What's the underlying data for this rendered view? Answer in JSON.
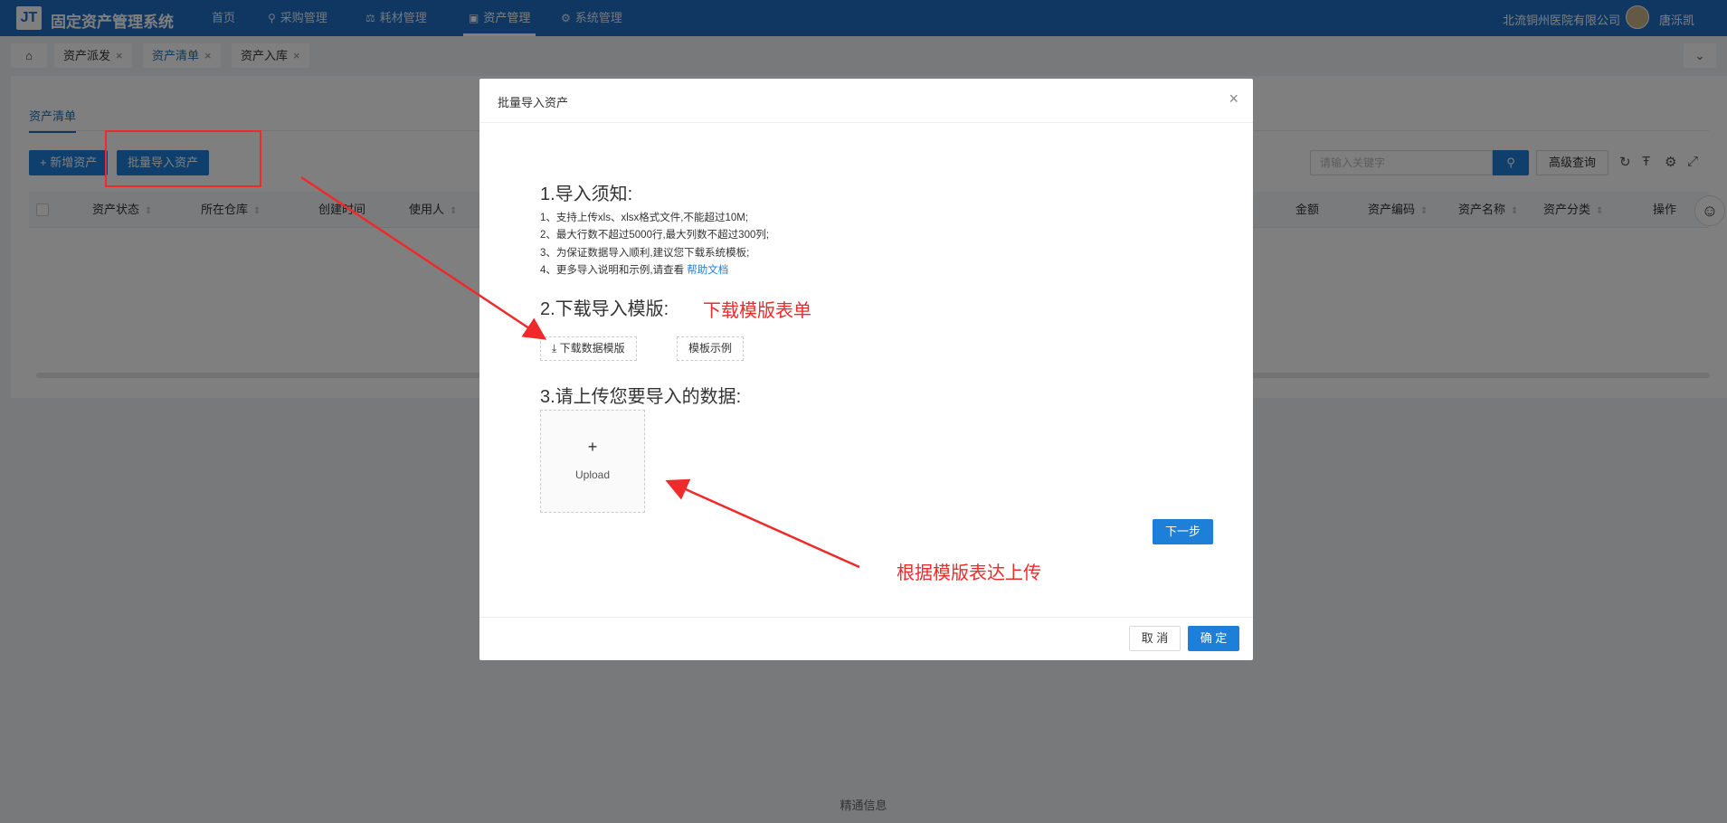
{
  "header": {
    "logo": "JT",
    "app_title": "固定资产管理系统",
    "nav": [
      "首页",
      "采购管理",
      "耗材管理",
      "资产管理",
      "系统管理"
    ],
    "company": "北流铜州医院有限公司",
    "username": "唐泺凯"
  },
  "tabs": [
    "资产派发",
    "资产清单",
    "资产入库"
  ],
  "card": {
    "tab": "资产清单",
    "add_button": "+ 新增资产",
    "import_button": "批量导入资产",
    "search_placeholder": "请输入关键字",
    "advanced_search": "高级查询",
    "columns_left": [
      "资产状态",
      "所在仓库",
      "创建时间",
      "使用人"
    ],
    "columns_right": [
      "金额",
      "资产编码",
      "资产名称",
      "资产分类",
      "操作"
    ]
  },
  "modal": {
    "title": "批量导入资产",
    "section1": "1.导入须知:",
    "notes": [
      "1、支持上传xls、xlsx格式文件,不能超过10M;",
      "2、最大行数不超过5000行,最大列数不超过300列;",
      "3、为保证数据导入顺利,建议您下载系统模板;",
      "4、更多导入说明和示例,请查看"
    ],
    "help_link": "帮助文档",
    "section2": "2.下载导入模版:",
    "download_button": "下载数据模版",
    "example_button": "模板示例",
    "section3": "3.请上传您要导入的数据:",
    "upload_label": "Upload",
    "next_button": "下一步",
    "cancel_button": "取 消",
    "ok_button": "确 定"
  },
  "annotations": {
    "download_hint": "下载模版表单",
    "upload_hint": "根据模版表达上传"
  },
  "footer": "精通信息"
}
